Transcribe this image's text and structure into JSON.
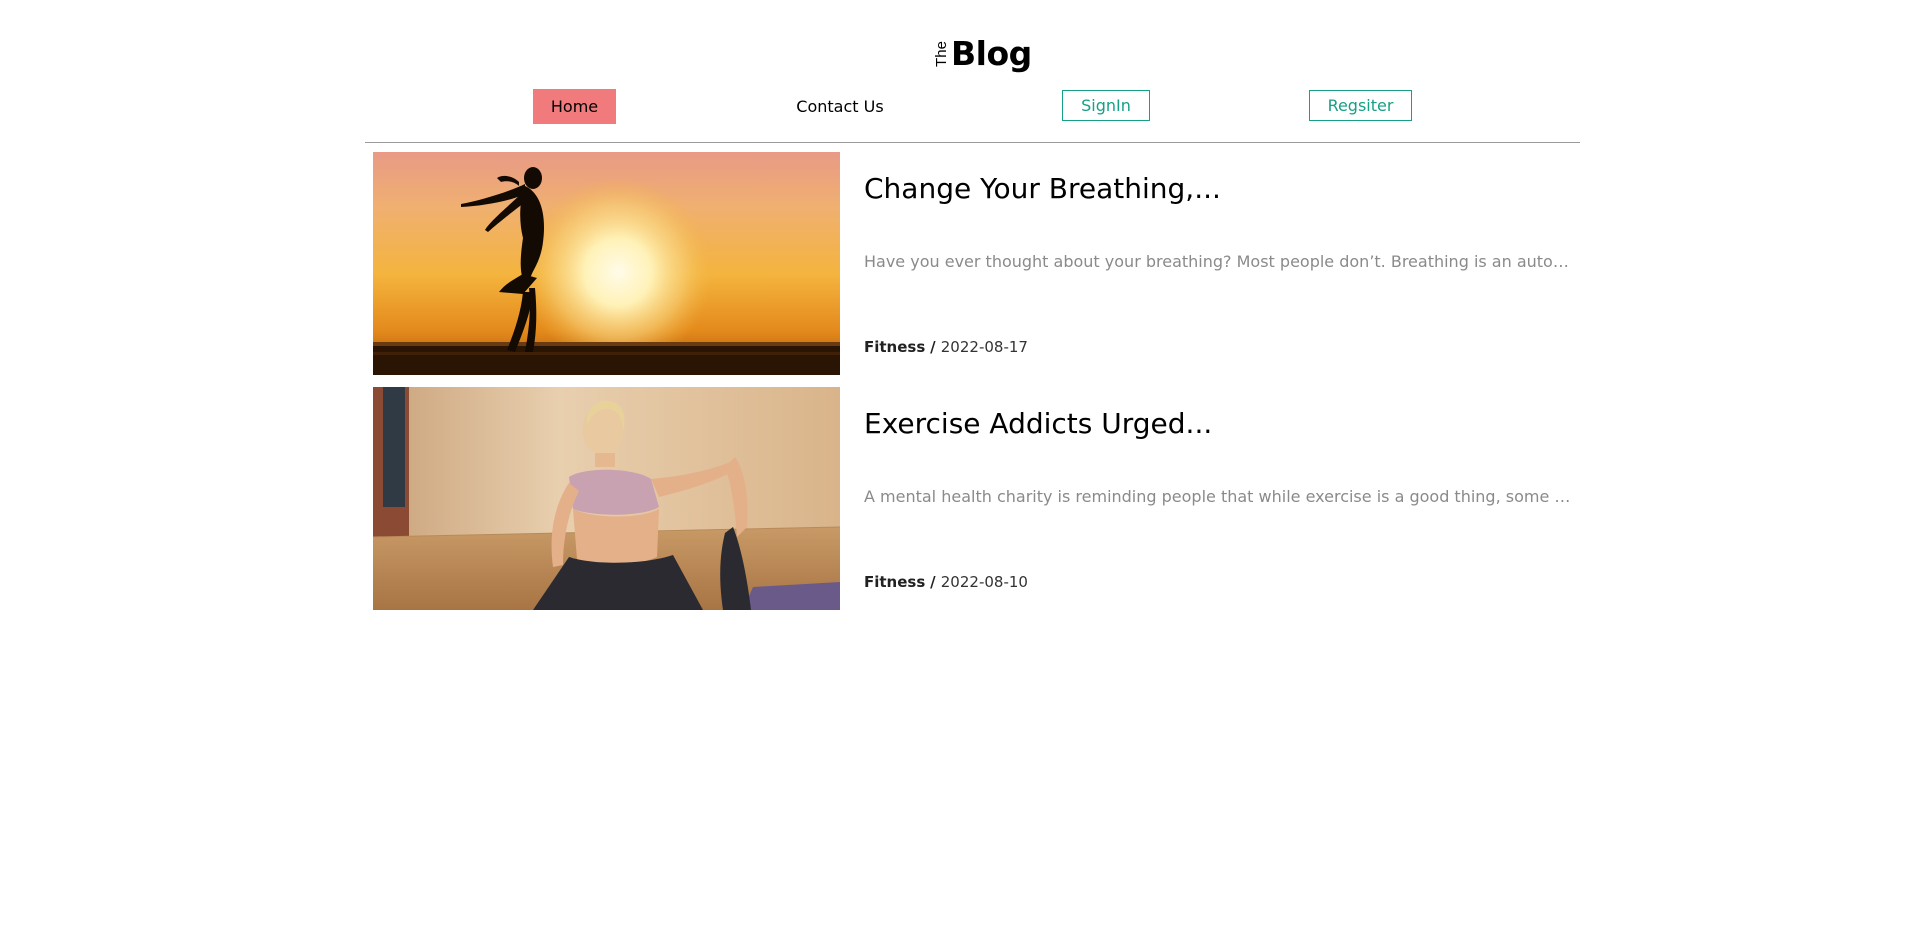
{
  "header": {
    "logo_the": "The",
    "logo_blog": "Blog"
  },
  "nav": {
    "home": "Home",
    "contact": "Contact Us",
    "signin": "SignIn",
    "register": "Regsiter"
  },
  "colors": {
    "home_active_bg": "#f07a7c",
    "accent": "#16a085",
    "excerpt_text": "#8a8a8a"
  },
  "posts": [
    {
      "title": "Change Your Breathing,...",
      "excerpt": "Have you ever thought about your breathing? Most people don’t. Breathing is an autom...",
      "category": "Fitness",
      "separator": "/",
      "date": "2022-08-17",
      "image": "sunset-silhouette-woman"
    },
    {
      "title": "Exercise Addicts Urged...",
      "excerpt": "A mental health charity is reminding people that while exercise is a good thing, some pe...",
      "category": "Fitness",
      "separator": "/",
      "date": "2022-08-10",
      "image": "woman-yoga-stretch"
    }
  ]
}
